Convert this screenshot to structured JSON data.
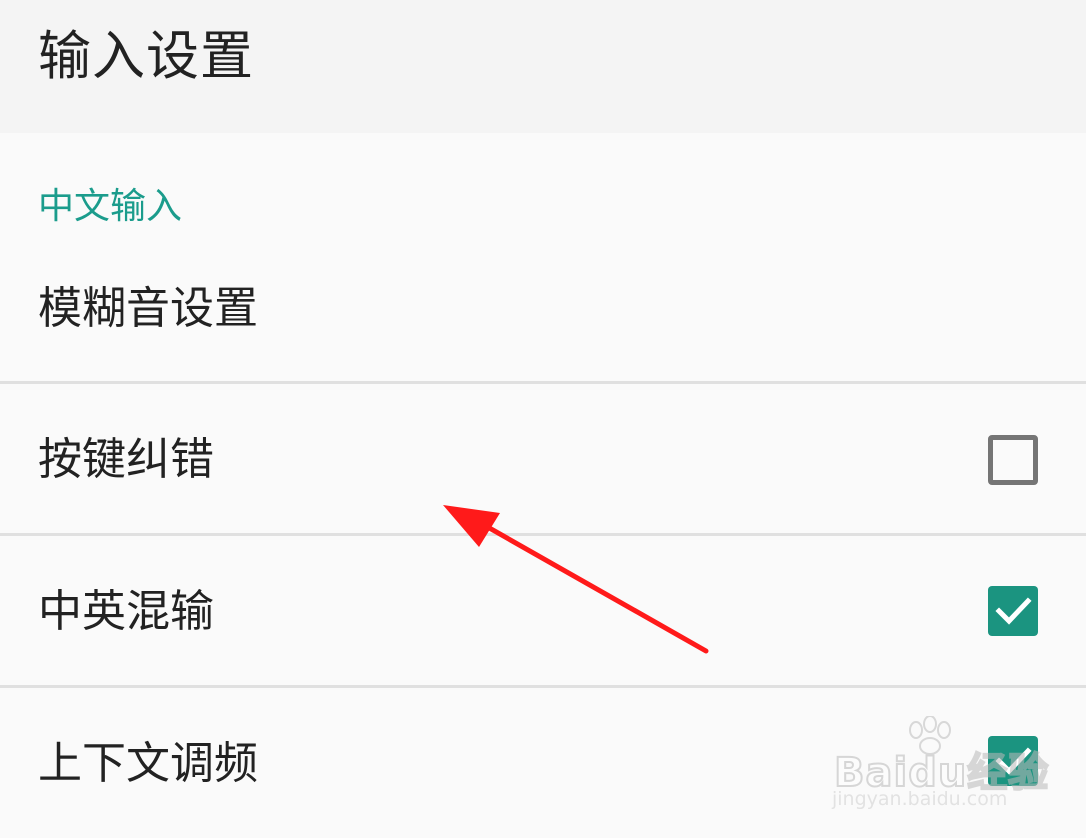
{
  "appbar": {
    "title": "输入设置"
  },
  "section": {
    "category_title": "中文输入",
    "items": [
      {
        "label": "模糊音设置",
        "checkbox": null
      },
      {
        "label": "按键纠错",
        "checkbox": "unchecked"
      },
      {
        "label": "中英混输",
        "checkbox": "checked"
      },
      {
        "label": "上下文调频",
        "checkbox": "checked"
      }
    ]
  },
  "colors": {
    "accent": "#1b9480",
    "category_text": "#1b9c8c",
    "annotation_arrow": "#ff1a1a"
  },
  "watermark": {
    "brand": "Baidu经验",
    "url": "jingyan.baidu.com"
  }
}
